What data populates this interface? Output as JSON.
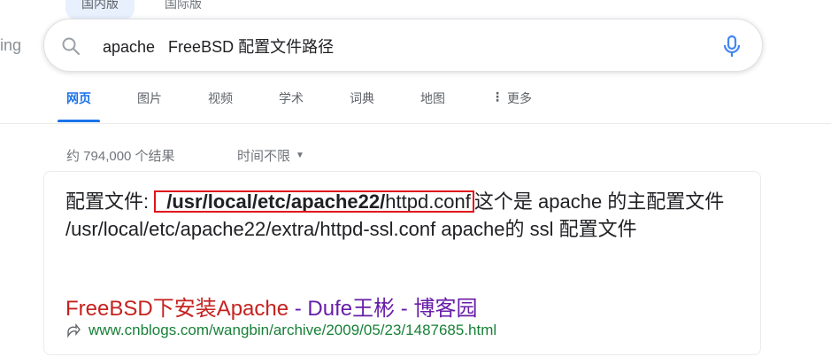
{
  "top_tabs": [
    "国内版",
    "国际版"
  ],
  "brand_fragment": "ing",
  "search": {
    "query": "apache   FreeBSD 配置文件路径"
  },
  "nav": {
    "items": [
      "网页",
      "图片",
      "视频",
      "学术",
      "词典",
      "地图"
    ],
    "more": "更多"
  },
  "results": {
    "count_text": "约 794,000 个结果",
    "time_filter": "时间不限"
  },
  "result": {
    "snippet_prefix": "配置文件: ",
    "snippet_bold": "/usr/local/etc/apache22/",
    "snippet_highlight_rest": "httpd.conf",
    "snippet_rest": "这个是 apache 的主配置文件 /usr/local/etc/apache22/extra/httpd-ssl.conf    apache的 ssl 配置文件",
    "title_part1": "FreeBSD下安装Apache",
    "title_sep1": " - ",
    "title_part2": "Dufe王彬",
    "title_sep2": " - ",
    "title_part3": "博客园",
    "url": "www.cnblogs.com/wangbin/archive/2009/05/23/1487685.html"
  },
  "colors": {
    "accent": "#1a73e8",
    "title_red": "#c5221f",
    "title_purple": "#681da8",
    "url_green": "#188038",
    "highlight_border": "#e0141b"
  }
}
